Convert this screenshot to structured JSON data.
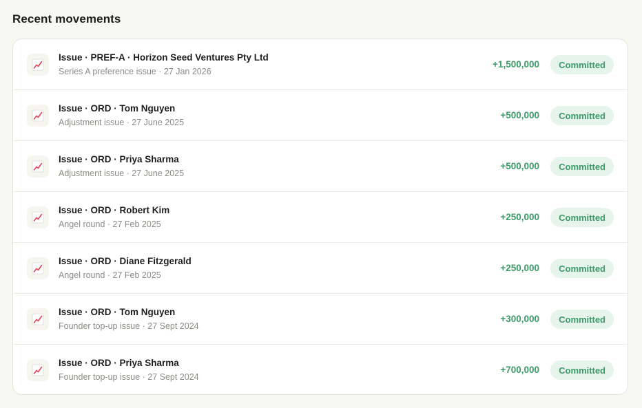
{
  "section": {
    "title": "Recent movements"
  },
  "colors": {
    "positive": "#3b9a68",
    "badge_bg": "#e6f4ec"
  },
  "movements": [
    {
      "icon": "chart-increasing-icon",
      "title": "Issue · PREF-A · Horizon Seed Ventures Pty Ltd",
      "subtitle": "Series A preference issue · 27 Jan 2026",
      "amount": "+1,500,000",
      "status": "Committed"
    },
    {
      "icon": "chart-increasing-icon",
      "title": "Issue · ORD · Tom Nguyen",
      "subtitle": "Adjustment issue · 27 June 2025",
      "amount": "+500,000",
      "status": "Committed"
    },
    {
      "icon": "chart-increasing-icon",
      "title": "Issue · ORD · Priya Sharma",
      "subtitle": "Adjustment issue · 27 June 2025",
      "amount": "+500,000",
      "status": "Committed"
    },
    {
      "icon": "chart-increasing-icon",
      "title": "Issue · ORD · Robert Kim",
      "subtitle": "Angel round · 27 Feb 2025",
      "amount": "+250,000",
      "status": "Committed"
    },
    {
      "icon": "chart-increasing-icon",
      "title": "Issue · ORD · Diane Fitzgerald",
      "subtitle": "Angel round · 27 Feb 2025",
      "amount": "+250,000",
      "status": "Committed"
    },
    {
      "icon": "chart-increasing-icon",
      "title": "Issue · ORD · Tom Nguyen",
      "subtitle": "Founder top-up issue · 27 Sept 2024",
      "amount": "+300,000",
      "status": "Committed"
    },
    {
      "icon": "chart-increasing-icon",
      "title": "Issue · ORD · Priya Sharma",
      "subtitle": "Founder top-up issue · 27 Sept 2024",
      "amount": "+700,000",
      "status": "Committed"
    }
  ]
}
